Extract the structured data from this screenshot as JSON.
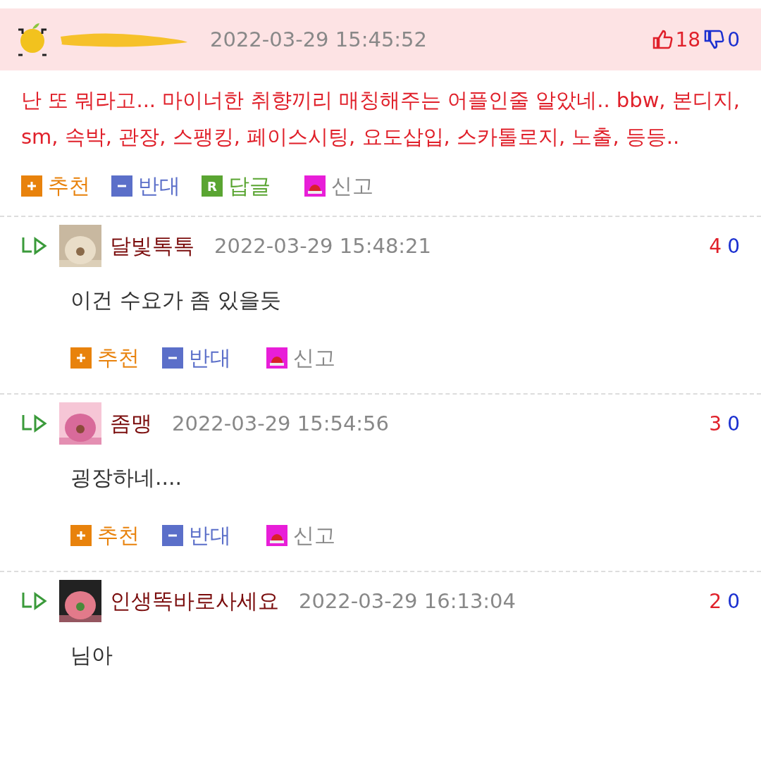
{
  "post": {
    "timestamp": "2022-03-29 15:45:52",
    "likes": "18",
    "dislikes": "0",
    "body": "난 또 뭐라고... 마이너한 취향끼리 매칭해주는 어플인줄 알았네.. bbw, 본디지, sm, 속박, 관장, 스팽킹, 페이스시팅, 요도삽입, 스카톨로지, 노출, 등등..",
    "actions": [
      {
        "kind": "recommend",
        "label": "추천"
      },
      {
        "kind": "oppose",
        "label": "반대"
      },
      {
        "kind": "reply",
        "label": "답글",
        "badge": "R"
      },
      {
        "kind": "report",
        "label": "신고"
      }
    ]
  },
  "replies": [
    {
      "author": "달빛톡톡",
      "timestamp": "2022-03-29 15:48:21",
      "likes": "4",
      "dislikes": "0",
      "body": "이건 수요가 좀 있을듯",
      "actions": [
        {
          "kind": "recommend",
          "label": "추천"
        },
        {
          "kind": "oppose",
          "label": "반대"
        },
        {
          "kind": "report",
          "label": "신고"
        }
      ]
    },
    {
      "author": "좀맹",
      "timestamp": "2022-03-29 15:54:56",
      "likes": "3",
      "dislikes": "0",
      "body": "굉장하네....",
      "actions": [
        {
          "kind": "recommend",
          "label": "추천"
        },
        {
          "kind": "oppose",
          "label": "반대"
        },
        {
          "kind": "report",
          "label": "신고"
        }
      ]
    },
    {
      "author": "인생똑바로사세요",
      "timestamp": "2022-03-29 16:13:04",
      "likes": "2",
      "dislikes": "0",
      "body": "님아"
    }
  ]
}
